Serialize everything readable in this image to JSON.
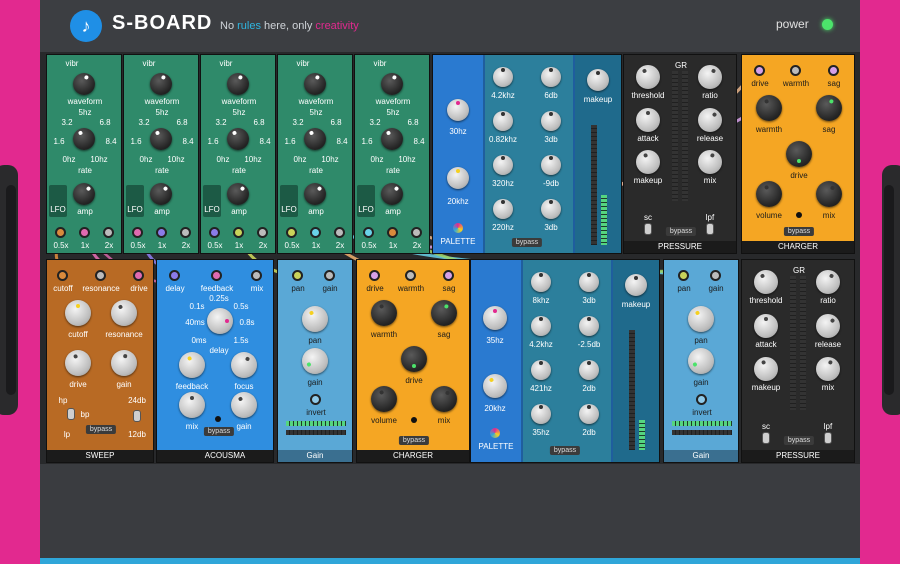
{
  "app": {
    "title": "S-BOARD",
    "tagline_pre": "No",
    "tagline_rules": "rules",
    "tagline_mid": "here, only",
    "tagline_creativity": "creativity",
    "power_label": "power"
  },
  "lfo": {
    "waveform": "waveform",
    "vibr": "vibr",
    "freq_top": "5hz",
    "freq_32": "3.2",
    "freq_68": "6.8",
    "freq_16": "1.6",
    "freq_84": "8.4",
    "freq_0": "0hz",
    "freq_10": "10hz",
    "rate": "rate",
    "amp": "amp",
    "name": "LFO",
    "x05": "0.5x",
    "x1": "1x",
    "x2": "2x"
  },
  "palette_top": {
    "lo_freq": "30hz",
    "hi_freq": "20khz",
    "name": "PALETTE",
    "bands": [
      "4.2khz",
      "0.82khz",
      "320hz",
      "220hz"
    ],
    "gains": [
      "6db",
      "3db",
      "-9db",
      "3db"
    ],
    "makeup": "makeup",
    "bypass": "bypass"
  },
  "pressure": {
    "gr": "GR",
    "threshold": "threshold",
    "ratio": "ratio",
    "attack": "attack",
    "release": "release",
    "makeup": "makeup",
    "mix": "mix",
    "sc": "sc",
    "lpf": "lpf",
    "bypass": "bypass",
    "name": "PRESSURE"
  },
  "charger": {
    "drive": "drive",
    "warmth": "warmth",
    "sag": "sag",
    "volume": "volume",
    "mix": "mix",
    "bypass": "bypass",
    "name": "CHARGER"
  },
  "sweep": {
    "cutoff": "cutoff",
    "resonance": "resonance",
    "drive": "drive",
    "gain": "gain",
    "hp": "hp",
    "bp": "bp",
    "lp": "lp",
    "db24": "24db",
    "db12": "12db",
    "bypass": "bypass",
    "name": "SWEEP"
  },
  "acousma": {
    "delay": "delay",
    "feedback": "feedback",
    "mix": "mix",
    "t025": "0.25s",
    "t01": "0.1s",
    "t05": "0.5s",
    "t40": "40ms",
    "t08": "0.8s",
    "t0": "0ms",
    "t15": "1.5s",
    "focus": "focus",
    "gain": "gain",
    "bypass": "bypass",
    "name": "ACOUSMA"
  },
  "gainmod": {
    "pan": "pan",
    "gain": "gain",
    "invert": "invert",
    "name": "Gain"
  },
  "palette_bot": {
    "lo_freq": "35hz",
    "hi_freq": "20khz",
    "name": "PALETTE",
    "bands": [
      "8khz",
      "4.2khz",
      "421hz",
      "35hz"
    ],
    "gains": [
      "3db",
      "-2.5db",
      "2db",
      "2db"
    ],
    "makeup": "makeup",
    "bypass": "bypass"
  },
  "colors": {
    "accent": "#e2298f",
    "blue": "#2fa6d9",
    "lfo_green": "#2f8a6a",
    "charger_orange": "#f5a623",
    "acousma_blue": "#2f8ee0",
    "gain_blue": "#5aa8d6",
    "palette_blue": "#1f5e9e",
    "sweep_brown": "#b86a24",
    "pressure_dark": "#2a2a2a"
  }
}
